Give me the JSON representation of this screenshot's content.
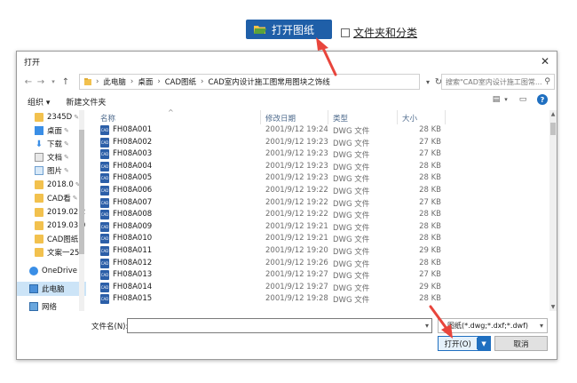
{
  "toolbar": {
    "open_drawing_label": "打开图纸",
    "folder_classify_label": "文件夹和分类"
  },
  "dialog": {
    "title": "打开",
    "close_glyph": "✕",
    "breadcrumb": [
      "此电脑",
      "桌面",
      "CAD图纸",
      "CAD室内设计施工图常用图块之饰线"
    ],
    "search_placeholder": "搜索\"CAD室内设计施工图常...",
    "cmd_organize": "组织 ▾",
    "cmd_new_folder": "新建文件夹",
    "sidebar": [
      {
        "label": "2345D",
        "pin": true,
        "icon": "folder-icon"
      },
      {
        "label": "桌面",
        "pin": true,
        "icon": "desktop-icon"
      },
      {
        "label": "下载",
        "pin": true,
        "icon": "download-icon"
      },
      {
        "label": "文档",
        "pin": true,
        "icon": "documents-icon"
      },
      {
        "label": "图片",
        "pin": true,
        "icon": "pictures-icon"
      },
      {
        "label": "2018.0",
        "pin": true,
        "icon": "folder-icon"
      },
      {
        "label": "CAD看",
        "pin": true,
        "icon": "folder-icon"
      },
      {
        "label": "2019.02.2",
        "pin": false,
        "icon": "folder-icon"
      },
      {
        "label": "2019.03.0",
        "pin": false,
        "icon": "folder-icon"
      },
      {
        "label": "CAD图纸",
        "pin": false,
        "icon": "folder-icon"
      },
      {
        "label": "文案一25",
        "pin": false,
        "icon": "folder-icon"
      },
      {
        "label": "OneDrive",
        "pin": false,
        "icon": "onedrive-icon"
      },
      {
        "label": "此电脑",
        "pin": false,
        "icon": "computer-icon"
      },
      {
        "label": "网络",
        "pin": false,
        "icon": "network-icon"
      }
    ],
    "columns": {
      "name": "名称",
      "date": "修改日期",
      "type": "类型",
      "size": "大小"
    },
    "files": [
      {
        "name": "FH08A001",
        "date": "2001/9/12 19:24",
        "type": "DWG 文件",
        "size": "28 KB"
      },
      {
        "name": "FH08A002",
        "date": "2001/9/12 19:23",
        "type": "DWG 文件",
        "size": "27 KB"
      },
      {
        "name": "FH08A003",
        "date": "2001/9/12 19:23",
        "type": "DWG 文件",
        "size": "27 KB"
      },
      {
        "name": "FH08A004",
        "date": "2001/9/12 19:23",
        "type": "DWG 文件",
        "size": "28 KB"
      },
      {
        "name": "FH08A005",
        "date": "2001/9/12 19:23",
        "type": "DWG 文件",
        "size": "28 KB"
      },
      {
        "name": "FH08A006",
        "date": "2001/9/12 19:22",
        "type": "DWG 文件",
        "size": "28 KB"
      },
      {
        "name": "FH08A007",
        "date": "2001/9/12 19:22",
        "type": "DWG 文件",
        "size": "27 KB"
      },
      {
        "name": "FH08A008",
        "date": "2001/9/12 19:22",
        "type": "DWG 文件",
        "size": "28 KB"
      },
      {
        "name": "FH08A009",
        "date": "2001/9/12 19:21",
        "type": "DWG 文件",
        "size": "28 KB"
      },
      {
        "name": "FH08A010",
        "date": "2001/9/12 19:21",
        "type": "DWG 文件",
        "size": "28 KB"
      },
      {
        "name": "FH08A011",
        "date": "2001/9/12 19:20",
        "type": "DWG 文件",
        "size": "29 KB"
      },
      {
        "name": "FH08A012",
        "date": "2001/9/12 19:26",
        "type": "DWG 文件",
        "size": "28 KB"
      },
      {
        "name": "FH08A013",
        "date": "2001/9/12 19:27",
        "type": "DWG 文件",
        "size": "27 KB"
      },
      {
        "name": "FH08A014",
        "date": "2001/9/12 19:27",
        "type": "DWG 文件",
        "size": "29 KB"
      },
      {
        "name": "FH08A015",
        "date": "2001/9/12 19:28",
        "type": "DWG 文件",
        "size": "28 KB"
      }
    ],
    "file_icon_text": "CAD",
    "filename_label": "文件名(N):",
    "filename_value": "",
    "filetype_value": "图纸(*.dwg;*.dxf;*.dwf)",
    "open_button": "打开(O)",
    "cancel_button": "取消"
  },
  "colors": {
    "accent": "#1f5fa8",
    "arrow": "#e8453c",
    "selection": "#cce4f7"
  }
}
